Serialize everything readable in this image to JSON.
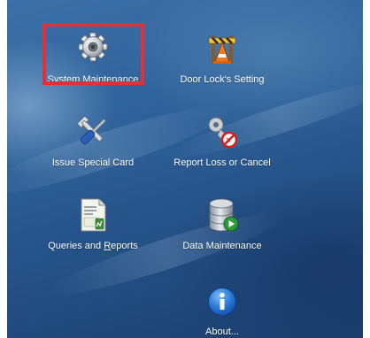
{
  "colors": {
    "highlight_border": "#e0303a",
    "label_text": "#ffffff"
  },
  "tiles": [
    {
      "label": "System Maintenance",
      "icon": "gear-icon",
      "highlighted": true
    },
    {
      "label": "Door Lock's Setting",
      "icon": "traffic-cone-barrier-icon"
    },
    {
      "label": "Issue Special Card",
      "icon": "wrench-screwdriver-icon"
    },
    {
      "label": "Report Loss or Cancel",
      "icon": "key-prohibited-icon"
    },
    {
      "label_before": "Queries and ",
      "label_accel": "R",
      "label_after": "eports",
      "icon": "report-document-icon"
    },
    {
      "label": "Data Maintenance",
      "icon": "database-play-icon"
    },
    {
      "label": "About...",
      "icon": "info-icon"
    }
  ]
}
